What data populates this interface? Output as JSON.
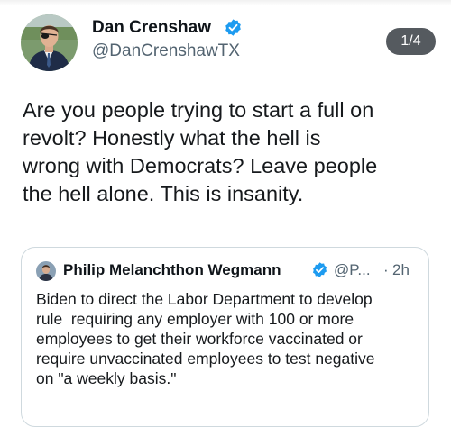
{
  "tweet": {
    "author_name": "Dan Crenshaw",
    "author_handle": "@DanCrenshawTX",
    "thread_position": "1/4",
    "text_lines": [
      "Are you people trying to start a full on",
      "revolt? Honestly what the hell is",
      "wrong with Democrats? Leave people",
      "the hell alone. This is insanity."
    ]
  },
  "quoted_tweet": {
    "author_name": "Philip Melanchthon Wegmann",
    "author_handle": "@P...",
    "separator": "·",
    "time": "2h",
    "text_lines": [
      "Biden to direct the Labor Department to develop",
      "rule  requiring any employer with 100 or more",
      "employees to get their workforce vaccinated or",
      "require unvaccinated employees to test negative",
      "on \"a weekly basis.\""
    ]
  },
  "colors": {
    "verified_badge": "#1d9bf0",
    "secondary_text": "#536471",
    "pill_background": "#555a5f",
    "card_border": "#cfd9de"
  }
}
